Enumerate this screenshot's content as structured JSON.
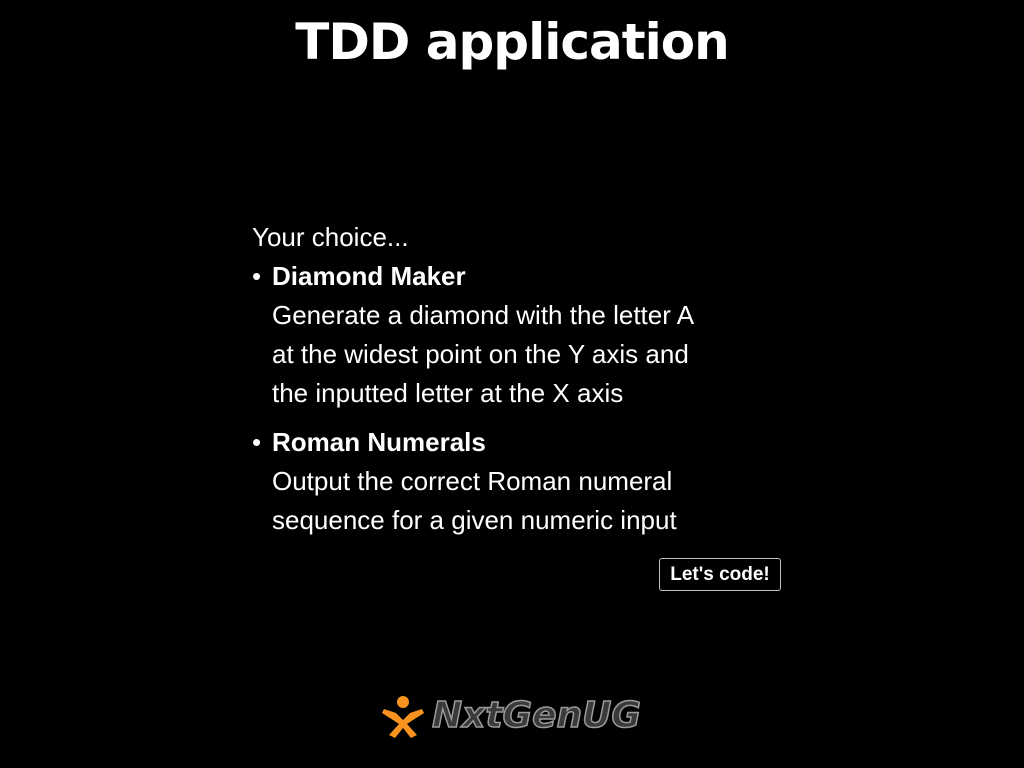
{
  "header": {
    "title": "TDD application"
  },
  "main": {
    "intro": "Your choice...",
    "choices": [
      {
        "name": "Diamond Maker",
        "description_lines": [
          "Generate a diamond with the letter A",
          "at the widest point on the Y axis and",
          "the inputted letter at the X axis"
        ]
      },
      {
        "name": "Roman Numerals",
        "description_lines": [
          "Output the correct Roman numeral",
          "sequence for a given numeric input"
        ]
      }
    ],
    "bullet": "•",
    "action_button_label": "Let's code!"
  },
  "footer": {
    "logo_text": "NxtGenUG",
    "logo_icon": "person-star-icon"
  },
  "colors": {
    "background": "#000000",
    "text": "#ffffff",
    "logo_orange": "#f7931e",
    "logo_text_gray": "#3a3a3a"
  }
}
